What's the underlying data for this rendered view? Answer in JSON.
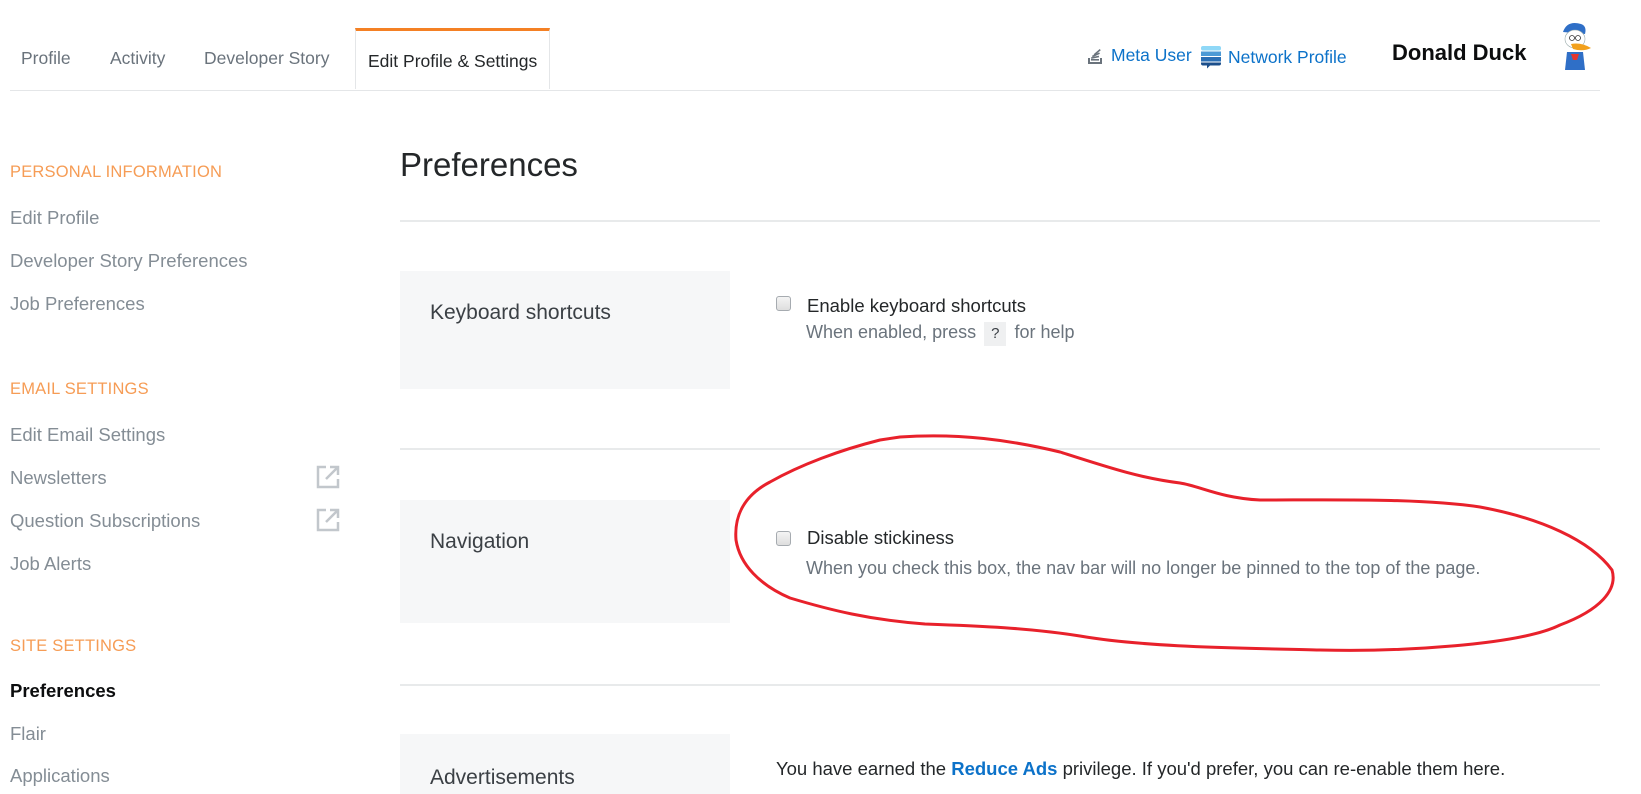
{
  "header": {
    "tabs": [
      {
        "label": "Profile",
        "active": false
      },
      {
        "label": "Activity",
        "active": false
      },
      {
        "label": "Developer Story",
        "active": false
      },
      {
        "label": "Edit Profile & Settings",
        "active": true
      }
    ],
    "links": [
      {
        "label": "Meta User",
        "icon": "stack-exchange-meta-icon"
      },
      {
        "label": "Network Profile",
        "icon": "stack-exchange-network-icon"
      }
    ],
    "user": {
      "name": "Donald Duck",
      "avatar": "donald-duck-avatar"
    }
  },
  "sidebar": {
    "sections": [
      {
        "heading": "PERSONAL INFORMATION",
        "items": [
          {
            "label": "Edit Profile"
          },
          {
            "label": "Developer Story Preferences"
          },
          {
            "label": "Job Preferences"
          }
        ]
      },
      {
        "heading": "EMAIL SETTINGS",
        "items": [
          {
            "label": "Edit Email Settings"
          },
          {
            "label": "Newsletters",
            "external": true
          },
          {
            "label": "Question Subscriptions",
            "external": true
          },
          {
            "label": "Job Alerts"
          }
        ]
      },
      {
        "heading": "SITE SETTINGS",
        "items": [
          {
            "label": "Preferences",
            "active": true
          },
          {
            "label": "Flair"
          },
          {
            "label": "Applications"
          }
        ]
      }
    ]
  },
  "main": {
    "title": "Preferences",
    "sections": [
      {
        "label": "Keyboard shortcuts",
        "option": {
          "label": "Enable keyboard shortcuts",
          "checked": false,
          "desc_before": "When enabled, press",
          "key": "?",
          "desc_after": "for help"
        }
      },
      {
        "label": "Navigation",
        "option": {
          "label": "Disable stickiness",
          "checked": false,
          "desc": "When you check this box, the nav bar will no longer be pinned to the top of the page."
        }
      },
      {
        "label": "Advertisements",
        "text_before": "You have earned the",
        "link": "Reduce Ads",
        "text_after": "privilege. If you'd prefer, you can re-enable them here."
      }
    ]
  },
  "annotation": {
    "shape": "freehand-ellipse",
    "color": "#e8212b",
    "target": "Navigation option"
  },
  "colors": {
    "accent_orange": "#f48024",
    "link_blue": "#0c72c9",
    "section_heading": "#f69c55"
  }
}
